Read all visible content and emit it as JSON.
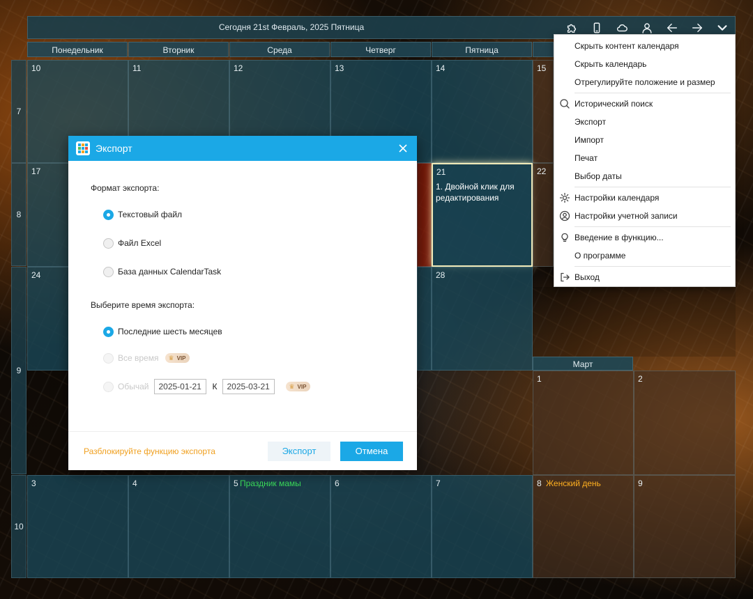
{
  "header": {
    "title": "Сегодня 21st Февраль, 2025 Пятница"
  },
  "weekdays": [
    "Понедельник",
    "Вторник",
    "Среда",
    "Четверг",
    "Пятница"
  ],
  "week_numbers": [
    "7",
    "8",
    "9",
    "10"
  ],
  "days": {
    "d10": "10",
    "d11": "11",
    "d12": "12",
    "d13": "13",
    "d14": "14",
    "d15": "15",
    "d17": "17",
    "d21": "21",
    "d22": "22",
    "d24": "24",
    "d28": "28",
    "m1": "1",
    "m2": "2",
    "m3": "3",
    "m4": "4",
    "m5": "5",
    "m6": "6",
    "m7": "7",
    "m8": "8",
    "m9": "9"
  },
  "events": {
    "today_task": "1. Двойной клик для редактирования",
    "march5_event": "Праздник мамы",
    "womens_day": "Женский день"
  },
  "month_label": "Март",
  "menu": {
    "items": [
      "Скрыть контент календаря",
      "Скрыть календарь",
      "Отрегулируйте положение и размер",
      "Исторический поиск",
      "Экспорт",
      "Импорт",
      "Печат",
      "Выбор даты",
      "Настройки календаря",
      "Настройки учетной записи",
      "Введение в функцию...",
      "О программе",
      "Выход"
    ]
  },
  "dialog": {
    "title": "Экспорт",
    "format_label": "Формат экспорта:",
    "formats": [
      "Текстовый файл",
      "Файл Excel",
      "База данных CalendarTask"
    ],
    "selected_format": "Текстовый файл",
    "time_label": "Выберите время экспорта:",
    "time_options": [
      "Последние шесть месяцев",
      "Все время",
      "Обычай"
    ],
    "selected_time": "Последние шесть месяцев",
    "vip_badge": "VIP",
    "date_from": "2025-01-21",
    "date_to_label": "К",
    "date_to": "2025-03-21",
    "unlock_link": "Разблокируйте функцию экспорта",
    "export_button": "Экспорт",
    "cancel_button": "Отмена"
  },
  "colors": {
    "accent": "#1ba8e6",
    "holiday": "#ffb020",
    "event_green": "#3bdc5a",
    "cell": "#19485a"
  }
}
